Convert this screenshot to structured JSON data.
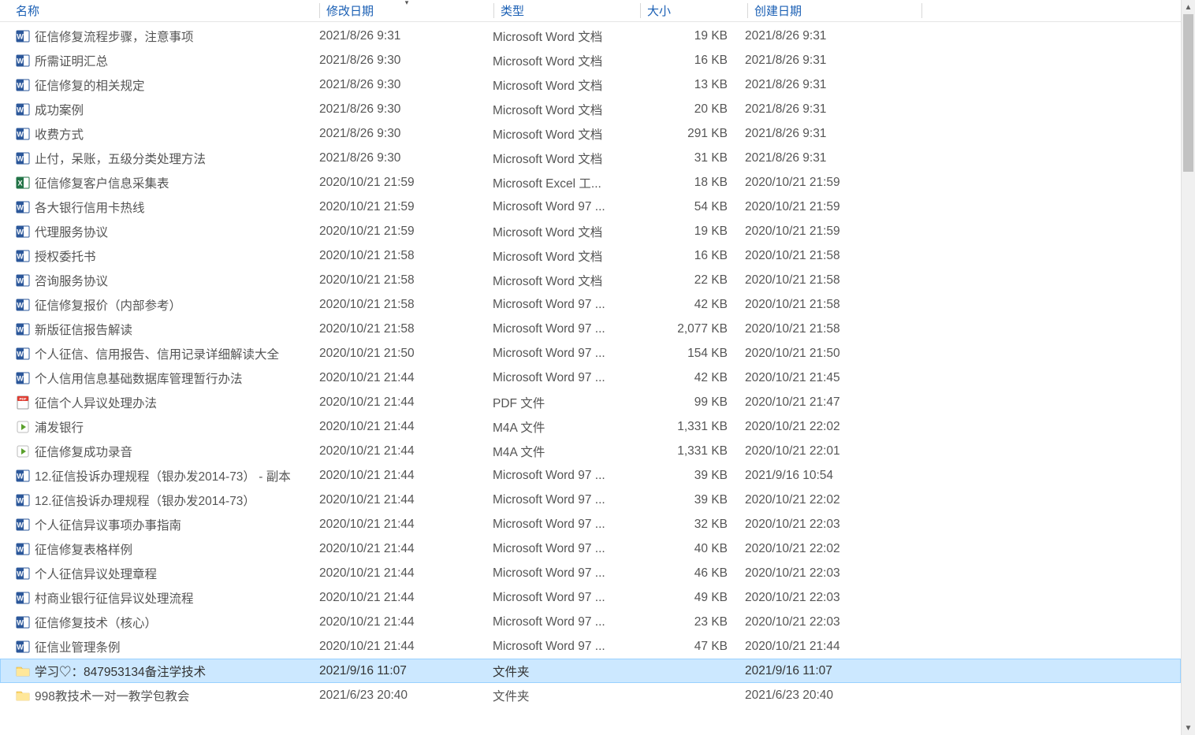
{
  "columns": {
    "name": "名称",
    "modified": "修改日期",
    "type": "类型",
    "size": "大小",
    "created": "创建日期"
  },
  "sort_column": "modified",
  "files": [
    {
      "icon": "word",
      "name": "征信修复流程步骤，注意事项",
      "mod": "2021/8/26 9:31",
      "type": "Microsoft Word 文档",
      "size": "19 KB",
      "created": "2021/8/26 9:31"
    },
    {
      "icon": "word",
      "name": "所需证明汇总",
      "mod": "2021/8/26 9:30",
      "type": "Microsoft Word 文档",
      "size": "16 KB",
      "created": "2021/8/26 9:31"
    },
    {
      "icon": "word",
      "name": "征信修复的相关规定",
      "mod": "2021/8/26 9:30",
      "type": "Microsoft Word 文档",
      "size": "13 KB",
      "created": "2021/8/26 9:31"
    },
    {
      "icon": "word",
      "name": "成功案例",
      "mod": "2021/8/26 9:30",
      "type": "Microsoft Word 文档",
      "size": "20 KB",
      "created": "2021/8/26 9:31"
    },
    {
      "icon": "word",
      "name": "收费方式",
      "mod": "2021/8/26 9:30",
      "type": "Microsoft Word 文档",
      "size": "291 KB",
      "created": "2021/8/26 9:31"
    },
    {
      "icon": "word",
      "name": "止付，呆账，五级分类处理方法",
      "mod": "2021/8/26 9:30",
      "type": "Microsoft Word 文档",
      "size": "31 KB",
      "created": "2021/8/26 9:31"
    },
    {
      "icon": "excel",
      "name": "征信修复客户信息采集表",
      "mod": "2020/10/21 21:59",
      "type": "Microsoft Excel 工...",
      "size": "18 KB",
      "created": "2020/10/21 21:59"
    },
    {
      "icon": "word",
      "name": "各大银行信用卡热线",
      "mod": "2020/10/21 21:59",
      "type": "Microsoft Word 97 ...",
      "size": "54 KB",
      "created": "2020/10/21 21:59"
    },
    {
      "icon": "word",
      "name": "代理服务协议",
      "mod": "2020/10/21 21:59",
      "type": "Microsoft Word 文档",
      "size": "19 KB",
      "created": "2020/10/21 21:59"
    },
    {
      "icon": "word",
      "name": "授权委托书",
      "mod": "2020/10/21 21:58",
      "type": "Microsoft Word 文档",
      "size": "16 KB",
      "created": "2020/10/21 21:58"
    },
    {
      "icon": "word",
      "name": "咨询服务协议",
      "mod": "2020/10/21 21:58",
      "type": "Microsoft Word 文档",
      "size": "22 KB",
      "created": "2020/10/21 21:58"
    },
    {
      "icon": "word",
      "name": "征信修复报价（内部参考）",
      "mod": "2020/10/21 21:58",
      "type": "Microsoft Word 97 ...",
      "size": "42 KB",
      "created": "2020/10/21 21:58"
    },
    {
      "icon": "word",
      "name": "新版征信报告解读",
      "mod": "2020/10/21 21:58",
      "type": "Microsoft Word 97 ...",
      "size": "2,077 KB",
      "created": "2020/10/21 21:58"
    },
    {
      "icon": "word",
      "name": "个人征信、信用报告、信用记录详细解读大全",
      "mod": "2020/10/21 21:50",
      "type": "Microsoft Word 97 ...",
      "size": "154 KB",
      "created": "2020/10/21 21:50"
    },
    {
      "icon": "word",
      "name": "个人信用信息基础数据库管理暂行办法",
      "mod": "2020/10/21 21:44",
      "type": "Microsoft Word 97 ...",
      "size": "42 KB",
      "created": "2020/10/21 21:45"
    },
    {
      "icon": "pdf",
      "name": "征信个人异议处理办法",
      "mod": "2020/10/21 21:44",
      "type": "PDF 文件",
      "size": "99 KB",
      "created": "2020/10/21 21:47"
    },
    {
      "icon": "media",
      "name": "浦发银行",
      "mod": "2020/10/21 21:44",
      "type": "M4A 文件",
      "size": "1,331 KB",
      "created": "2020/10/21 22:02"
    },
    {
      "icon": "media",
      "name": "征信修复成功录音",
      "mod": "2020/10/21 21:44",
      "type": "M4A 文件",
      "size": "1,331 KB",
      "created": "2020/10/21 22:01"
    },
    {
      "icon": "word",
      "name": "12.征信投诉办理规程（银办发2014-73） - 副本",
      "mod": "2020/10/21 21:44",
      "type": "Microsoft Word 97 ...",
      "size": "39 KB",
      "created": "2021/9/16 10:54"
    },
    {
      "icon": "word",
      "name": "12.征信投诉办理规程（银办发2014-73）",
      "mod": "2020/10/21 21:44",
      "type": "Microsoft Word 97 ...",
      "size": "39 KB",
      "created": "2020/10/21 22:02"
    },
    {
      "icon": "word",
      "name": "个人征信异议事项办事指南",
      "mod": "2020/10/21 21:44",
      "type": "Microsoft Word 97 ...",
      "size": "32 KB",
      "created": "2020/10/21 22:03"
    },
    {
      "icon": "word",
      "name": "征信修复表格样例",
      "mod": "2020/10/21 21:44",
      "type": "Microsoft Word 97 ...",
      "size": "40 KB",
      "created": "2020/10/21 22:02"
    },
    {
      "icon": "word",
      "name": "个人征信异议处理章程",
      "mod": "2020/10/21 21:44",
      "type": "Microsoft Word 97 ...",
      "size": "46 KB",
      "created": "2020/10/21 22:03"
    },
    {
      "icon": "word",
      "name": "村商业银行征信异议处理流程",
      "mod": "2020/10/21 21:44",
      "type": "Microsoft Word 97 ...",
      "size": "49 KB",
      "created": "2020/10/21 22:03"
    },
    {
      "icon": "word",
      "name": "征信修复技术（核心）",
      "mod": "2020/10/21 21:44",
      "type": "Microsoft Word 97 ...",
      "size": "23 KB",
      "created": "2020/10/21 22:03"
    },
    {
      "icon": "word",
      "name": "征信业管理条例",
      "mod": "2020/10/21 21:44",
      "type": "Microsoft Word 97 ...",
      "size": "47 KB",
      "created": "2020/10/21 21:44"
    },
    {
      "icon": "folder",
      "name": "学习♡：847953134备注学技术",
      "mod": "2021/9/16 11:07",
      "type": "文件夹",
      "size": "",
      "created": "2021/9/16 11:07",
      "selected": true
    },
    {
      "icon": "folder",
      "name": "998教技术一对一教学包教会",
      "mod": "2021/6/23 20:40",
      "type": "文件夹",
      "size": "",
      "created": "2021/6/23 20:40"
    }
  ]
}
